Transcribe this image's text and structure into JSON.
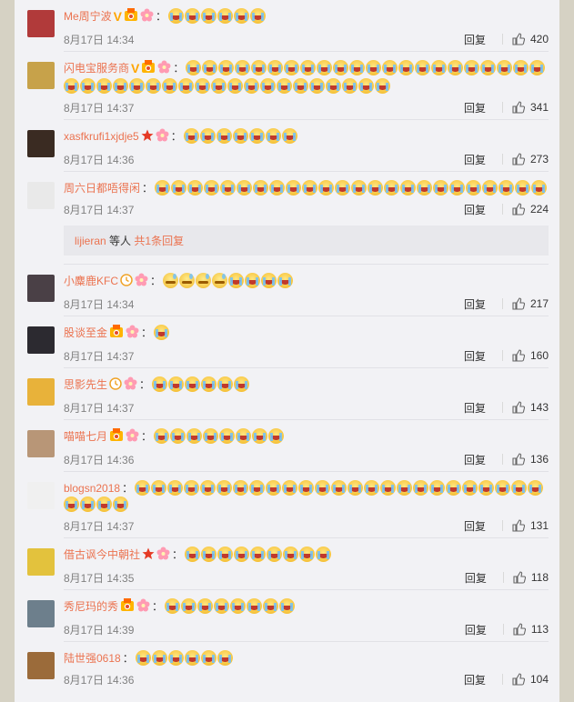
{
  "colors": {
    "link": "#eb7350",
    "meta": "#808080",
    "panel": "#f2f2f5",
    "outer": "#d6d2c4"
  },
  "icons": {
    "vip": "v-verified-icon",
    "medal": "medal-icon",
    "flower": "flower-icon",
    "star": "red-star-icon",
    "clock": "clock-badge-icon",
    "like": "thumb-up-icon",
    "emoji": "crying-emoji"
  },
  "comments": [
    {
      "user": "Me周宁波",
      "colon": "：",
      "badges": [
        "v",
        "medal",
        "flower"
      ],
      "emojis": 6,
      "emoji_kind": "cry",
      "time": "8月17日 14:34",
      "reply": "回复",
      "likes": "420",
      "avatar": "#b13a3a"
    },
    {
      "user": "闪电宝服务商",
      "colon": "：",
      "badges": [
        "v",
        "medal",
        "flower"
      ],
      "emojis": 42,
      "emoji_kind": "cry",
      "time": "8月17日 14:37",
      "reply": "回复",
      "likes": "341",
      "avatar": "#c7a24a"
    },
    {
      "user": "xasfkrufi1xjdje5",
      "colon": "：",
      "badges": [
        "star",
        "flower"
      ],
      "emojis": 7,
      "emoji_kind": "cry",
      "time": "8月17日 14:36",
      "reply": "回复",
      "likes": "273",
      "avatar": "#3a2b22"
    },
    {
      "user": "周六日都唔得闲",
      "colon": "：",
      "badges": [],
      "emojis": 24,
      "emoji_kind": "cry",
      "time": "8月17日 14:37",
      "reply": "回复",
      "likes": "224",
      "avatar": "#e9e9e9",
      "subreply": {
        "user": "lijieran",
        "text": "等人",
        "count": "共1条回复"
      }
    },
    {
      "user": "小麋鹿KFC",
      "colon": "：",
      "badges": [
        "clock",
        "flower"
      ],
      "emojis": 8,
      "emoji_kind": "mixed",
      "time": "8月17日 14:34",
      "reply": "回复",
      "likes": "217",
      "avatar": "#4a4046"
    },
    {
      "user": "股谈至金",
      "colon": "：",
      "badges": [
        "medal",
        "flower"
      ],
      "emojis": 1,
      "emoji_kind": "cry",
      "time": "8月17日 14:37",
      "reply": "回复",
      "likes": "160",
      "avatar": "#2c2a30"
    },
    {
      "user": "思影先生",
      "colon": "：",
      "badges": [
        "clock",
        "flower"
      ],
      "emojis": 6,
      "emoji_kind": "cry",
      "time": "8月17日 14:37",
      "reply": "回复",
      "likes": "143",
      "avatar": "#e8b23a"
    },
    {
      "user": "喵喵七月",
      "colon": "：",
      "badges": [
        "medal",
        "flower"
      ],
      "emojis": 8,
      "emoji_kind": "cry",
      "time": "8月17日 14:36",
      "reply": "回复",
      "likes": "136",
      "avatar": "#b89677"
    },
    {
      "user": "blogsn2018",
      "colon": "：",
      "badges": [],
      "emojis": 29,
      "emoji_kind": "cry",
      "time": "8月17日 14:37",
      "reply": "回复",
      "likes": "131",
      "avatar": "#f0f0f0"
    },
    {
      "user": "借古讽今中朝社",
      "colon": "：",
      "badges": [
        "star",
        "flower"
      ],
      "emojis": 9,
      "emoji_kind": "cry",
      "time": "8月17日 14:35",
      "reply": "回复",
      "likes": "118",
      "avatar": "#e3c23d"
    },
    {
      "user": "秀尼玛的秀",
      "colon": "：",
      "badges": [
        "medal",
        "flower"
      ],
      "emojis": 8,
      "emoji_kind": "cry",
      "time": "8月17日 14:39",
      "reply": "回复",
      "likes": "113",
      "avatar": "#6d7f8c"
    },
    {
      "user": "陆世强0618",
      "colon": "：",
      "badges": [],
      "emojis": 6,
      "emoji_kind": "cry",
      "time": "8月17日 14:36",
      "reply": "回复",
      "likes": "104",
      "avatar": "#9b6b3a"
    }
  ]
}
